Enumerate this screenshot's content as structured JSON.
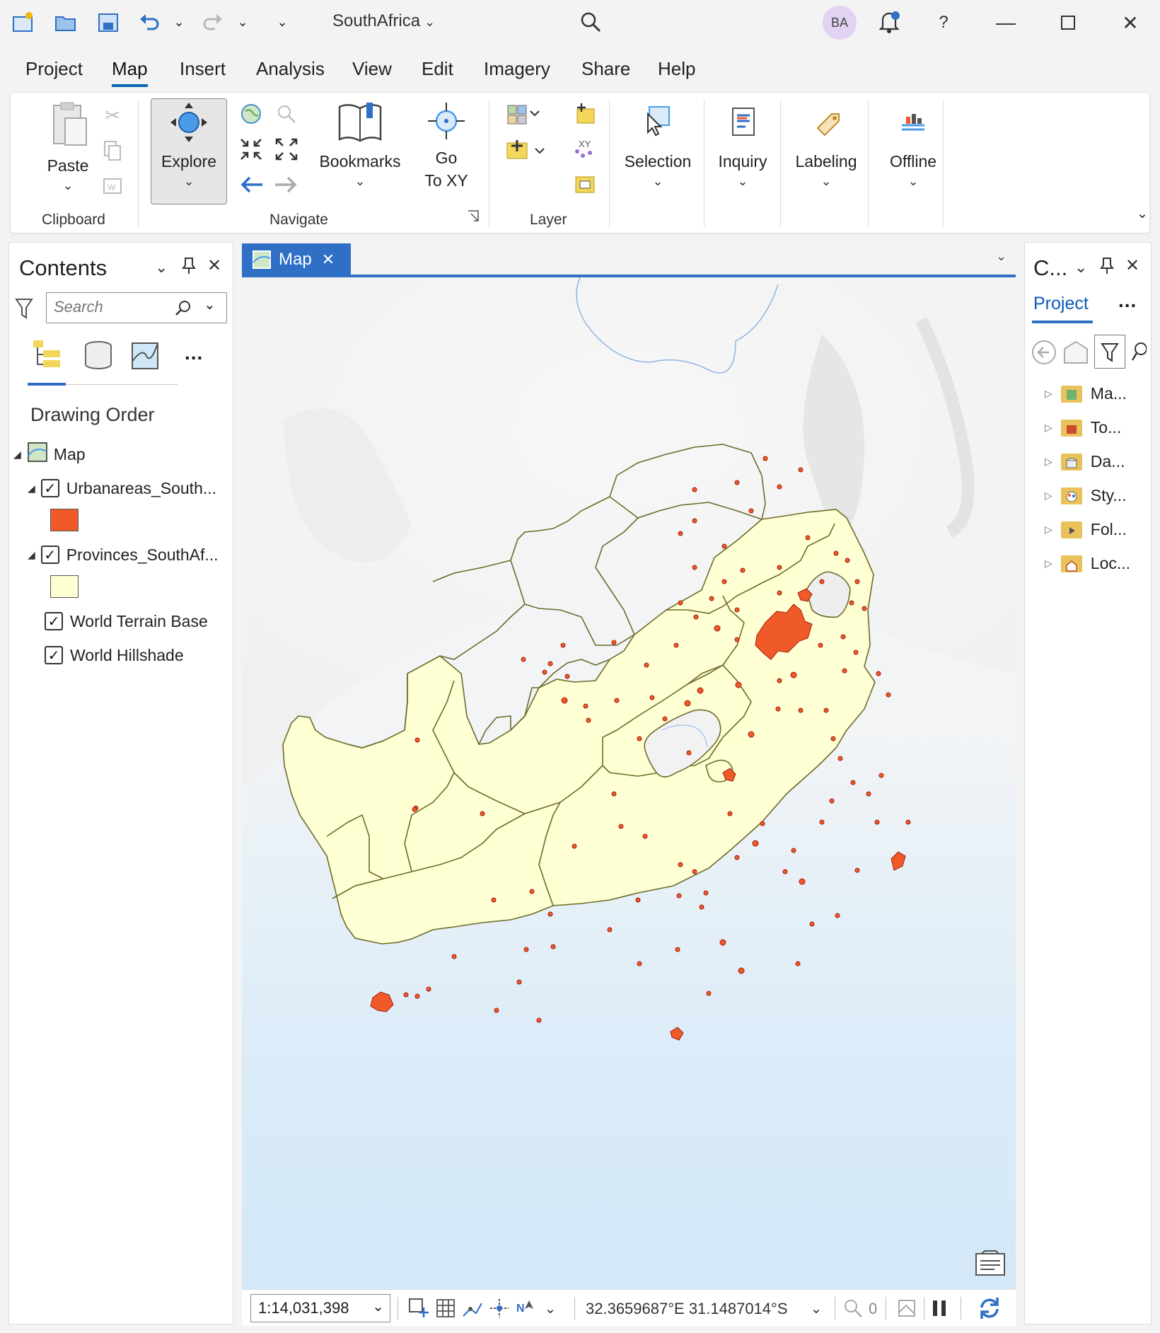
{
  "app": {
    "project_title": "SouthAfrica",
    "avatar_initials": "BA",
    "help_label": "?"
  },
  "menu": {
    "tabs": [
      "Project",
      "Map",
      "Insert",
      "Analysis",
      "View",
      "Edit",
      "Imagery",
      "Share",
      "Help"
    ],
    "active_tab": "Map"
  },
  "ribbon": {
    "clipboard": {
      "paste_label": "Paste",
      "group_label": "Clipboard"
    },
    "navigate": {
      "explore_label": "Explore",
      "bookmarks_label": "Bookmarks",
      "goto_line1": "Go",
      "goto_line2": "To XY",
      "group_label": "Navigate"
    },
    "layer": {
      "group_label": "Layer"
    },
    "selection_label": "Selection",
    "inquiry_label": "Inquiry",
    "labeling_label": "Labeling",
    "offline_label": "Offline"
  },
  "contents": {
    "title": "Contents",
    "search_placeholder": "Search",
    "more_label": "...",
    "drawing_order_label": "Drawing Order",
    "map_label": "Map",
    "layers": [
      {
        "name": "Urbanareas_South...",
        "checked": true,
        "swatch_color": "#f05a28"
      },
      {
        "name": "Provinces_SouthAf...",
        "checked": true,
        "swatch_color": "#ffffd4"
      },
      {
        "name": "World Terrain Base",
        "checked": true
      },
      {
        "name": "World Hillshade",
        "checked": true
      }
    ]
  },
  "map_tab": {
    "label": "Map"
  },
  "catalog": {
    "title": "C...",
    "tab_label": "Project",
    "more_label": "...",
    "items": [
      "Ma...",
      "To...",
      "Da...",
      "Sty...",
      "Fol...",
      "Loc..."
    ]
  },
  "status": {
    "scale": "1:14,031,398",
    "coordinates": "32.3659687°E 31.1487014°S",
    "selected_count": "0"
  },
  "colors": {
    "accent": "#2f6fc6",
    "province_fill": "#ffffd4",
    "province_stroke": "#6b6b2a",
    "urban_fill": "#f05a28",
    "urban_stroke": "#a01d0c",
    "ocean": "#d6ecfb"
  }
}
